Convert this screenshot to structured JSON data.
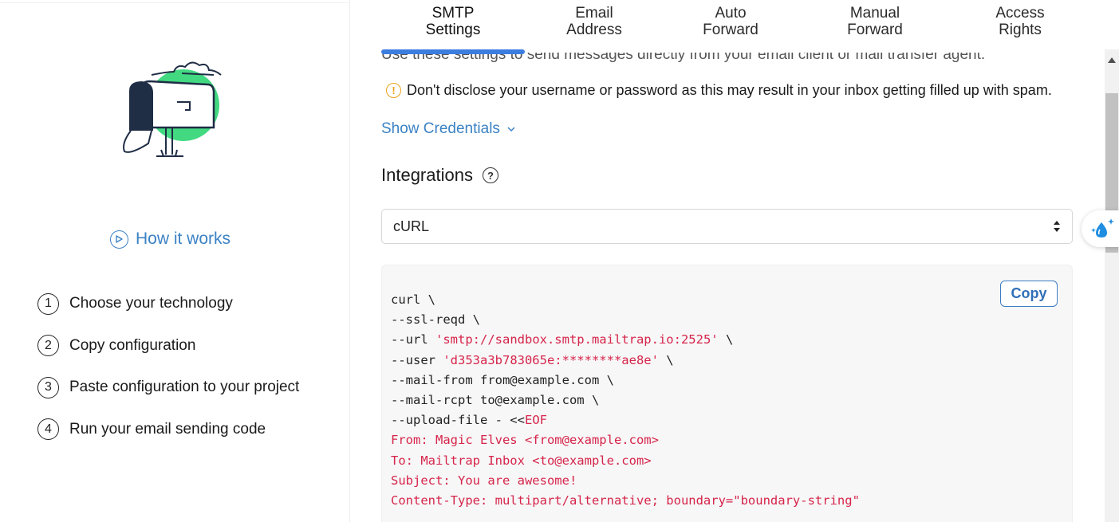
{
  "left": {
    "how_it_works_label": "How it works",
    "steps": [
      {
        "num": "1",
        "label": "Choose your technology"
      },
      {
        "num": "2",
        "label": "Copy configuration"
      },
      {
        "num": "3",
        "label": "Paste configuration to your project"
      },
      {
        "num": "4",
        "label": "Run your email sending code"
      }
    ],
    "illustration_icon": "mailbox-illustration"
  },
  "tabs": [
    {
      "line1": "SMTP",
      "line2": "Settings",
      "active": true
    },
    {
      "line1": "Email",
      "line2": "Address",
      "active": false
    },
    {
      "line1": "Auto",
      "line2": "Forward",
      "active": false
    },
    {
      "line1": "Manual",
      "line2": "Forward",
      "active": false
    },
    {
      "line1": "Access",
      "line2": "Rights",
      "active": false
    }
  ],
  "main": {
    "cutoff_text": "Use these settings to send messages directly from your email client or mail transfer agent.",
    "warning_text": "Don't disclose your username or password as this may result in your inbox getting filled up with spam.",
    "show_credentials_label": "Show Credentials",
    "integrations_title": "Integrations",
    "integration_selected": "cURL",
    "copy_label": "Copy",
    "code": {
      "l1": "curl \\",
      "l2": "--ssl-reqd \\",
      "l3a": "--url ",
      "l3s": "'smtp://sandbox.smtp.mailtrap.io:2525'",
      "l3b": " \\",
      "l4a": "--user ",
      "l4s": "'d353a3b783065e:********ae8e'",
      "l4b": " \\",
      "l5": "--mail-from from@example.com \\",
      "l6": "--mail-rcpt to@example.com \\",
      "l7a": "--upload-file - <<",
      "l7s": "EOF",
      "l8": "From: Magic Elves <from@example.com>",
      "l9": "To: Mailtrap Inbox <to@example.com>",
      "l10": "Subject: You are awesome!",
      "l11": "Content-Type: multipart/alternative; boundary=\"boundary-string\""
    }
  },
  "colors": {
    "accent": "#3b82c4",
    "tab_underline": "#3b7de0",
    "warning": "#e9a21b",
    "code_string": "#d6244a",
    "illustration_green": "#2ed573",
    "illustration_navy": "#1f2d45"
  },
  "icons": {
    "play": "play-circle-icon",
    "warning": "warning-circle-icon",
    "chevron": "chevron-down-icon",
    "help": "question-circle-icon",
    "select": "select-arrows-icon",
    "float": "water-drop-sparkle-icon"
  }
}
